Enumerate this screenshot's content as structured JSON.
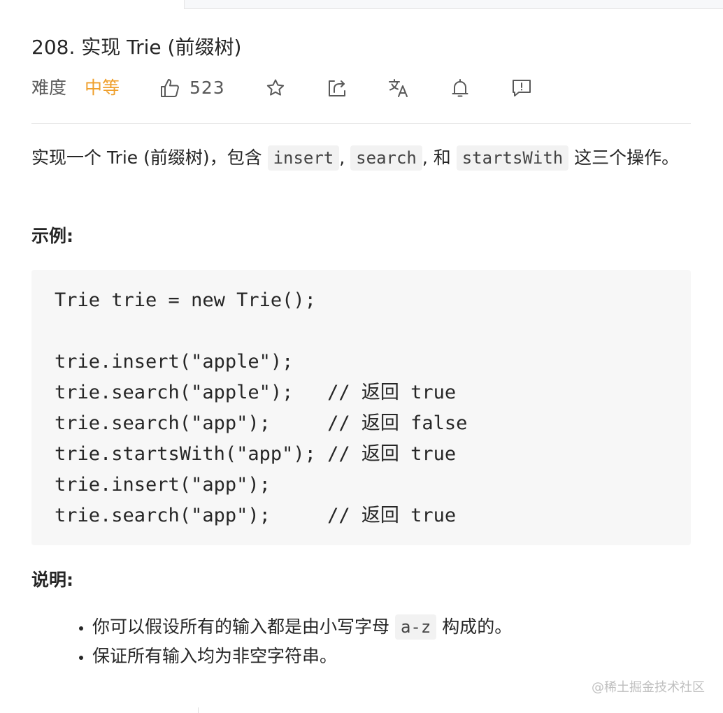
{
  "problem": {
    "title": "208. 实现 Trie (前缀树)",
    "difficulty_label": "难度",
    "difficulty_value": "中等",
    "likes": "523"
  },
  "toolbar_icons": [
    "like-icon",
    "star-icon",
    "share-icon",
    "translate-icon",
    "bell-icon",
    "feedback-icon"
  ],
  "colors": {
    "difficulty_medium": "#ef9f2b",
    "code_background": "#f7f7f7",
    "inline_code_background": "#f2f2f2"
  },
  "description": {
    "prefix": "实现一个 Trie (前缀树)，包含 ",
    "code_insert": "insert",
    "sep1": ", ",
    "code_search": "search",
    "sep2": ", 和 ",
    "code_startswith": "startsWith",
    "suffix": " 这三个操作。"
  },
  "example": {
    "heading": "示例:",
    "code": "Trie trie = new Trie();\n\ntrie.insert(\"apple\");\ntrie.search(\"apple\");   // 返回 true\ntrie.search(\"app\");     // 返回 false\ntrie.startsWith(\"app\"); // 返回 true\ntrie.insert(\"app\");\ntrie.search(\"app\");     // 返回 true"
  },
  "notes": {
    "heading": "说明:",
    "item1_prefix": "你可以假设所有的输入都是由小写字母 ",
    "item1_code": "a-z",
    "item1_suffix": " 构成的。",
    "item2": "保证所有输入均为非空字符串。"
  },
  "watermark": "@稀土掘金技术社区"
}
